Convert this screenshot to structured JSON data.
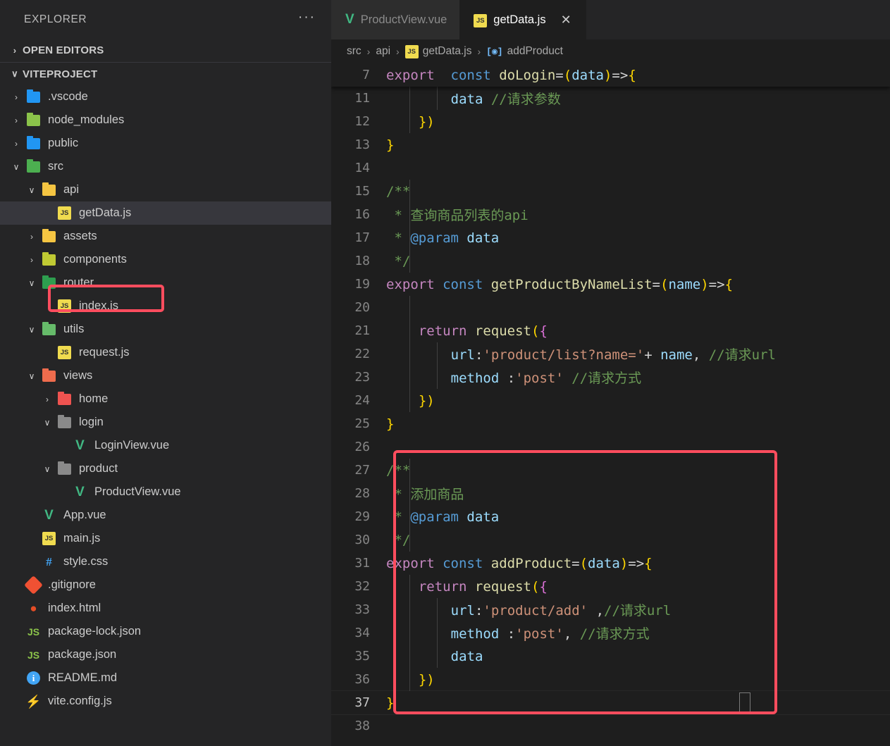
{
  "sidebar": {
    "title": "EXPLORER",
    "more_label": "···",
    "sections": [
      {
        "label": "OPEN EDITORS",
        "twisty": "›"
      },
      {
        "label": "VITEPROJECT",
        "twisty": "∨"
      }
    ],
    "items": [
      {
        "label": ".vscode",
        "twisty": "›",
        "icon": "folder-vscode-icon",
        "depth": 1,
        "type": "folder"
      },
      {
        "label": "node_modules",
        "twisty": "›",
        "icon": "folder-node-icon",
        "depth": 1,
        "type": "folder"
      },
      {
        "label": "public",
        "twisty": "›",
        "icon": "folder-public-icon",
        "depth": 1,
        "type": "folder"
      },
      {
        "label": "src",
        "twisty": "∨",
        "icon": "folder-src-icon",
        "depth": 1,
        "type": "folder"
      },
      {
        "label": "api",
        "twisty": "∨",
        "icon": "folder-api-icon",
        "depth": 2,
        "type": "folder"
      },
      {
        "label": "getData.js",
        "twisty": "",
        "icon": "js-file-icon",
        "depth": 3,
        "type": "file",
        "selected": true
      },
      {
        "label": "assets",
        "twisty": "›",
        "icon": "folder-assets-icon",
        "depth": 2,
        "type": "folder"
      },
      {
        "label": "components",
        "twisty": "›",
        "icon": "folder-components-icon",
        "depth": 2,
        "type": "folder"
      },
      {
        "label": "router",
        "twisty": "∨",
        "icon": "folder-router-icon",
        "depth": 2,
        "type": "folder"
      },
      {
        "label": "index.js",
        "twisty": "",
        "icon": "js-file-icon",
        "depth": 3,
        "type": "file"
      },
      {
        "label": "utils",
        "twisty": "∨",
        "icon": "folder-utils-icon",
        "depth": 2,
        "type": "folder"
      },
      {
        "label": "request.js",
        "twisty": "",
        "icon": "js-file-icon",
        "depth": 3,
        "type": "file"
      },
      {
        "label": "views",
        "twisty": "∨",
        "icon": "folder-views-icon",
        "depth": 2,
        "type": "folder"
      },
      {
        "label": "home",
        "twisty": "›",
        "icon": "folder-home-icon",
        "depth": 3,
        "type": "folder"
      },
      {
        "label": "login",
        "twisty": "∨",
        "icon": "folder-icon",
        "depth": 3,
        "type": "folder"
      },
      {
        "label": "LoginView.vue",
        "twisty": "",
        "icon": "vue-file-icon",
        "depth": 4,
        "type": "file"
      },
      {
        "label": "product",
        "twisty": "∨",
        "icon": "folder-icon",
        "depth": 3,
        "type": "folder"
      },
      {
        "label": "ProductView.vue",
        "twisty": "",
        "icon": "vue-file-icon",
        "depth": 4,
        "type": "file"
      },
      {
        "label": "App.vue",
        "twisty": "",
        "icon": "vue-file-icon",
        "depth": 2,
        "type": "file"
      },
      {
        "label": "main.js",
        "twisty": "",
        "icon": "js-file-icon",
        "depth": 2,
        "type": "file"
      },
      {
        "label": "style.css",
        "twisty": "",
        "icon": "css-file-icon",
        "depth": 2,
        "type": "file"
      },
      {
        "label": ".gitignore",
        "twisty": "",
        "icon": "git-file-icon",
        "depth": 1,
        "type": "file"
      },
      {
        "label": "index.html",
        "twisty": "",
        "icon": "html-file-icon",
        "depth": 1,
        "type": "file"
      },
      {
        "label": "package-lock.json",
        "twisty": "",
        "icon": "json-file-icon",
        "depth": 1,
        "type": "file"
      },
      {
        "label": "package.json",
        "twisty": "",
        "icon": "json-file-icon",
        "depth": 1,
        "type": "file"
      },
      {
        "label": "README.md",
        "twisty": "",
        "icon": "readme-file-icon",
        "depth": 1,
        "type": "file"
      },
      {
        "label": "vite.config.js",
        "twisty": "",
        "icon": "vite-file-icon",
        "depth": 1,
        "type": "file"
      }
    ]
  },
  "tabs": [
    {
      "label": "ProductView.vue",
      "icon": "vue-file-icon",
      "active": false,
      "close": ""
    },
    {
      "label": "getData.js",
      "icon": "js-file-icon",
      "active": true,
      "close": "✕"
    }
  ],
  "breadcrumb": {
    "sep": "›",
    "items": [
      {
        "label": "src",
        "icon": ""
      },
      {
        "label": "api",
        "icon": ""
      },
      {
        "label": "getData.js",
        "icon": "js-file-icon"
      },
      {
        "label": "addProduct",
        "icon": "symbol-field-icon"
      }
    ]
  },
  "editor": {
    "sticky_line": {
      "no": "7",
      "text": "export  const doLogin=(data)=>{"
    },
    "lines": [
      {
        "no": "11",
        "text": "        data //请求参数"
      },
      {
        "no": "12",
        "text": "    })"
      },
      {
        "no": "13",
        "text": "}"
      },
      {
        "no": "14",
        "text": ""
      },
      {
        "no": "15",
        "text": "/**"
      },
      {
        "no": "16",
        "text": " * 查询商品列表的api"
      },
      {
        "no": "17",
        "text": " * @param data"
      },
      {
        "no": "18",
        "text": " */"
      },
      {
        "no": "19",
        "text": "export const getProductByNameList=(name)=>{"
      },
      {
        "no": "20",
        "text": ""
      },
      {
        "no": "21",
        "text": "    return request({"
      },
      {
        "no": "22",
        "text": "        url:'product/list?name='+ name, //请求url"
      },
      {
        "no": "23",
        "text": "        method :'post' //请求方式"
      },
      {
        "no": "24",
        "text": "    })"
      },
      {
        "no": "25",
        "text": "}"
      },
      {
        "no": "26",
        "text": ""
      },
      {
        "no": "27",
        "text": "/**"
      },
      {
        "no": "28",
        "text": " * 添加商品"
      },
      {
        "no": "29",
        "text": " * @param data"
      },
      {
        "no": "30",
        "text": " */"
      },
      {
        "no": "31",
        "text": "export const addProduct=(data)=>{"
      },
      {
        "no": "32",
        "text": "    return request({"
      },
      {
        "no": "33",
        "text": "        url:'product/add' ,//请求url"
      },
      {
        "no": "34",
        "text": "        method :'post', //请求方式"
      },
      {
        "no": "35",
        "text": "        data"
      },
      {
        "no": "36",
        "text": "    })"
      },
      {
        "no": "37",
        "text": "}",
        "active": true
      },
      {
        "no": "38",
        "text": ""
      }
    ]
  },
  "annotations": {
    "tree_box_color": "#ff4d5e",
    "code_box_color": "#ff4d5e"
  }
}
